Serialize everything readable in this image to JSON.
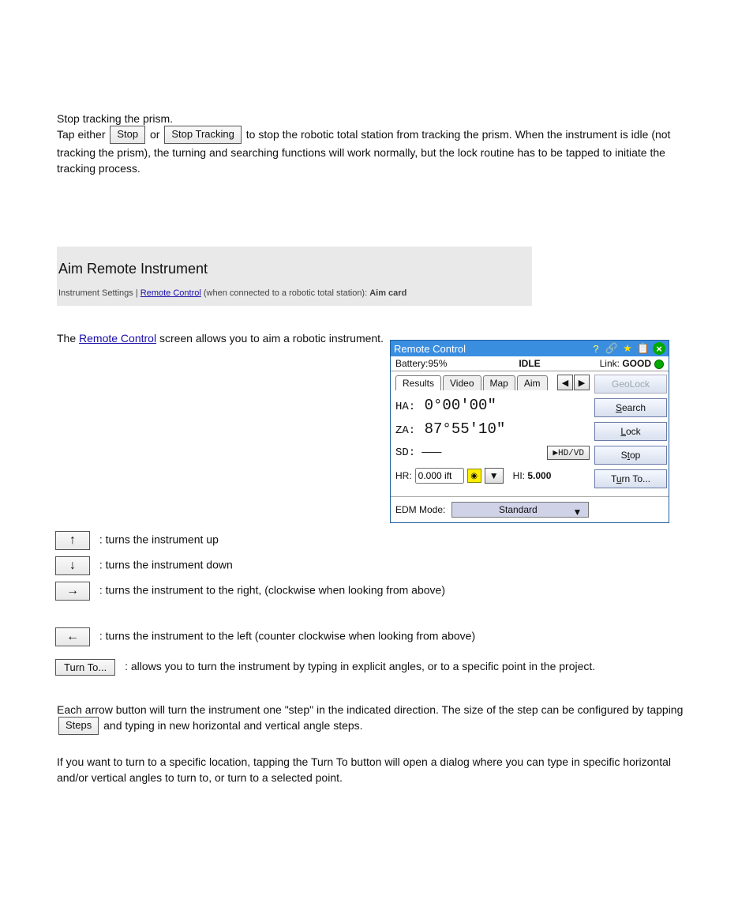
{
  "bodytext": {
    "line1": "Stop tracking the prism.",
    "line2_a": "Tap either ",
    "btn_stop": "Stop",
    "line2_b": " or ",
    "btn_stop_tracking": "Stop Tracking",
    "line2_c": " to stop the robotic total station from tracking the prism. When the instrument is idle (not tracking the prism), the turning and searching functions will work normally, but the lock routine has to be tapped to initiate the tracking process."
  },
  "heading": {
    "title": "Aim Remote Instrument",
    "src_label": "Instrument Settings",
    "src_link_text": "Remote Control",
    "src_after": " (when connected to a robotic total station): ",
    "src_bold": "Aim card"
  },
  "intro_a": "The ",
  "intro_link": "Remote Control",
  "intro_b": " screen allows you to aim a robotic instrument.",
  "keys": {
    "up": {
      "glyph": "↑",
      "text": " : turns the instrument up"
    },
    "down": {
      "glyph": "↓",
      "text": " : turns the instrument down"
    },
    "right_a": " : turns the instrument to the right, (clockwise when looking from above)",
    "right_glyph": "→",
    "left_a": " : turns the instrument to the left (counter clockwise when looking from above)",
    "left_glyph": "←",
    "turnto": "Turn To...",
    "turnto_text": " : allows you to turn the instrument by typing in explicit angles, or to a specific point in the project."
  },
  "panel": {
    "title": "Remote Control",
    "battery": "Battery:95%",
    "state": "IDLE",
    "link_label": "Link:",
    "link_value": "GOOD",
    "tabs": [
      "Results",
      "Video",
      "Map",
      "Aim"
    ],
    "ha_label": "HA:",
    "ha_value": "0°00'00\"",
    "za_label": "ZA:",
    "za_value": "87°55'10\"",
    "sd_label": "SD:",
    "sd_value": "———",
    "hdvd": "▶HD/VD",
    "hr_label": "HR:",
    "hr_value": "0.000 ift",
    "hi_label": "HI:",
    "hi_value": "5.000",
    "edm_label": "EDM Mode:",
    "edm_value": "Standard",
    "buttons": {
      "geolock": "GeoLock",
      "search": "Search",
      "lock": "Lock",
      "stop": "Stop",
      "turnto": "Turn To..."
    }
  },
  "sec3": {
    "a_1": "Each arrow button will turn the instrument one \"step\" in the indicated direction. The size of the step can be configured by tapping ",
    "a_btn": "Steps",
    "a_2": " and typing in new horizontal and vertical angle steps.",
    "b": "If you want to turn to a specific location, tapping the Turn To button will open a dialog where you can type in specific horizontal and/or vertical angles to turn to, or turn to a selected point."
  }
}
